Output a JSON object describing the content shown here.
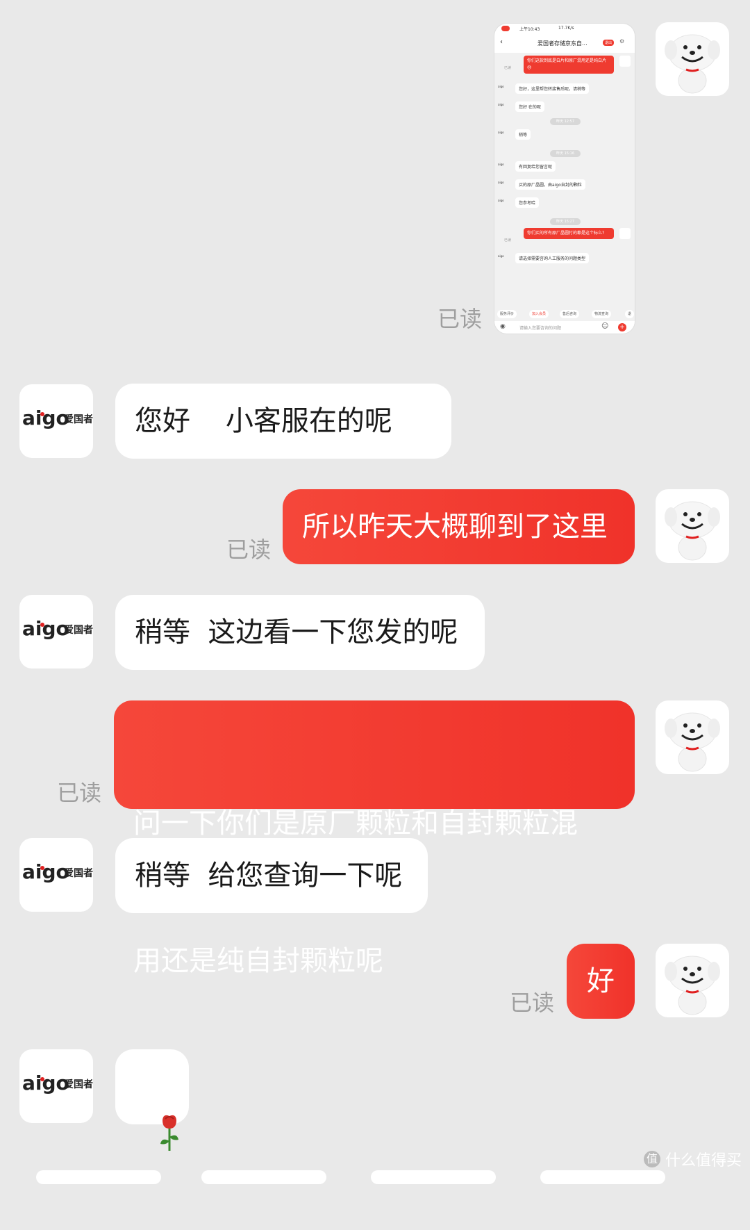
{
  "colors": {
    "background": "#e9e9e9",
    "accent": "#f0322a",
    "bubble_in": "#ffffff",
    "read_text": "#9e9e9e"
  },
  "read_label": "已读",
  "agent": {
    "logo_text": "aigo",
    "logo_sub": "爱国者"
  },
  "screenshot": {
    "status_time": "上午10:43",
    "status_right": "17.7K/s",
    "title": "爱国者存储京东自...",
    "badge": "退出",
    "messages": [
      {
        "side": "out",
        "text": "你们这款到底是白片和原厂混用还是纯白片😓"
      },
      {
        "side": "in",
        "text": "您好，这里帮您转接售后呢，请稍等"
      },
      {
        "side": "in",
        "text": "您好    在的呢"
      },
      {
        "side": "time",
        "text": "昨天 12:57"
      },
      {
        "side": "in",
        "text": "稍等"
      },
      {
        "side": "time",
        "text": "昨天 15:16"
      },
      {
        "side": "in",
        "text": "有回复给您留言呢"
      },
      {
        "side": "in",
        "text": "买的原厂晶圆，由aigo自封的颗粒"
      },
      {
        "side": "in",
        "text": "您参考哈"
      },
      {
        "side": "time",
        "text": "昨天 15:27"
      },
      {
        "side": "out",
        "text": "你们买的所有原厂晶圆打的都是这个标么?"
      },
      {
        "side": "in",
        "text": "请选择需要咨询人工服务的问题类型"
      }
    ],
    "tabs": [
      "服务评价",
      "加入会员",
      "售后咨询",
      "物流查询",
      "退"
    ],
    "input_placeholder": "请输入您要咨询的问题",
    "read_small": "已读"
  },
  "messages": [
    {
      "side": "in",
      "text": "您好    小客服在的呢"
    },
    {
      "side": "out",
      "text": "所以昨天大概聊到了这里"
    },
    {
      "side": "in",
      "text": "稍等  这边看一下您发的呢"
    },
    {
      "side": "out",
      "line1": "问一下你们是原厂颗粒和自封颗粒混",
      "line2": "用还是纯自封颗粒呢"
    },
    {
      "side": "in",
      "text": "稍等  给您查询一下呢"
    },
    {
      "side": "out",
      "text": "好"
    },
    {
      "side": "in",
      "text": "🌹"
    }
  ],
  "footer": {
    "watermark": "什么值得买"
  }
}
